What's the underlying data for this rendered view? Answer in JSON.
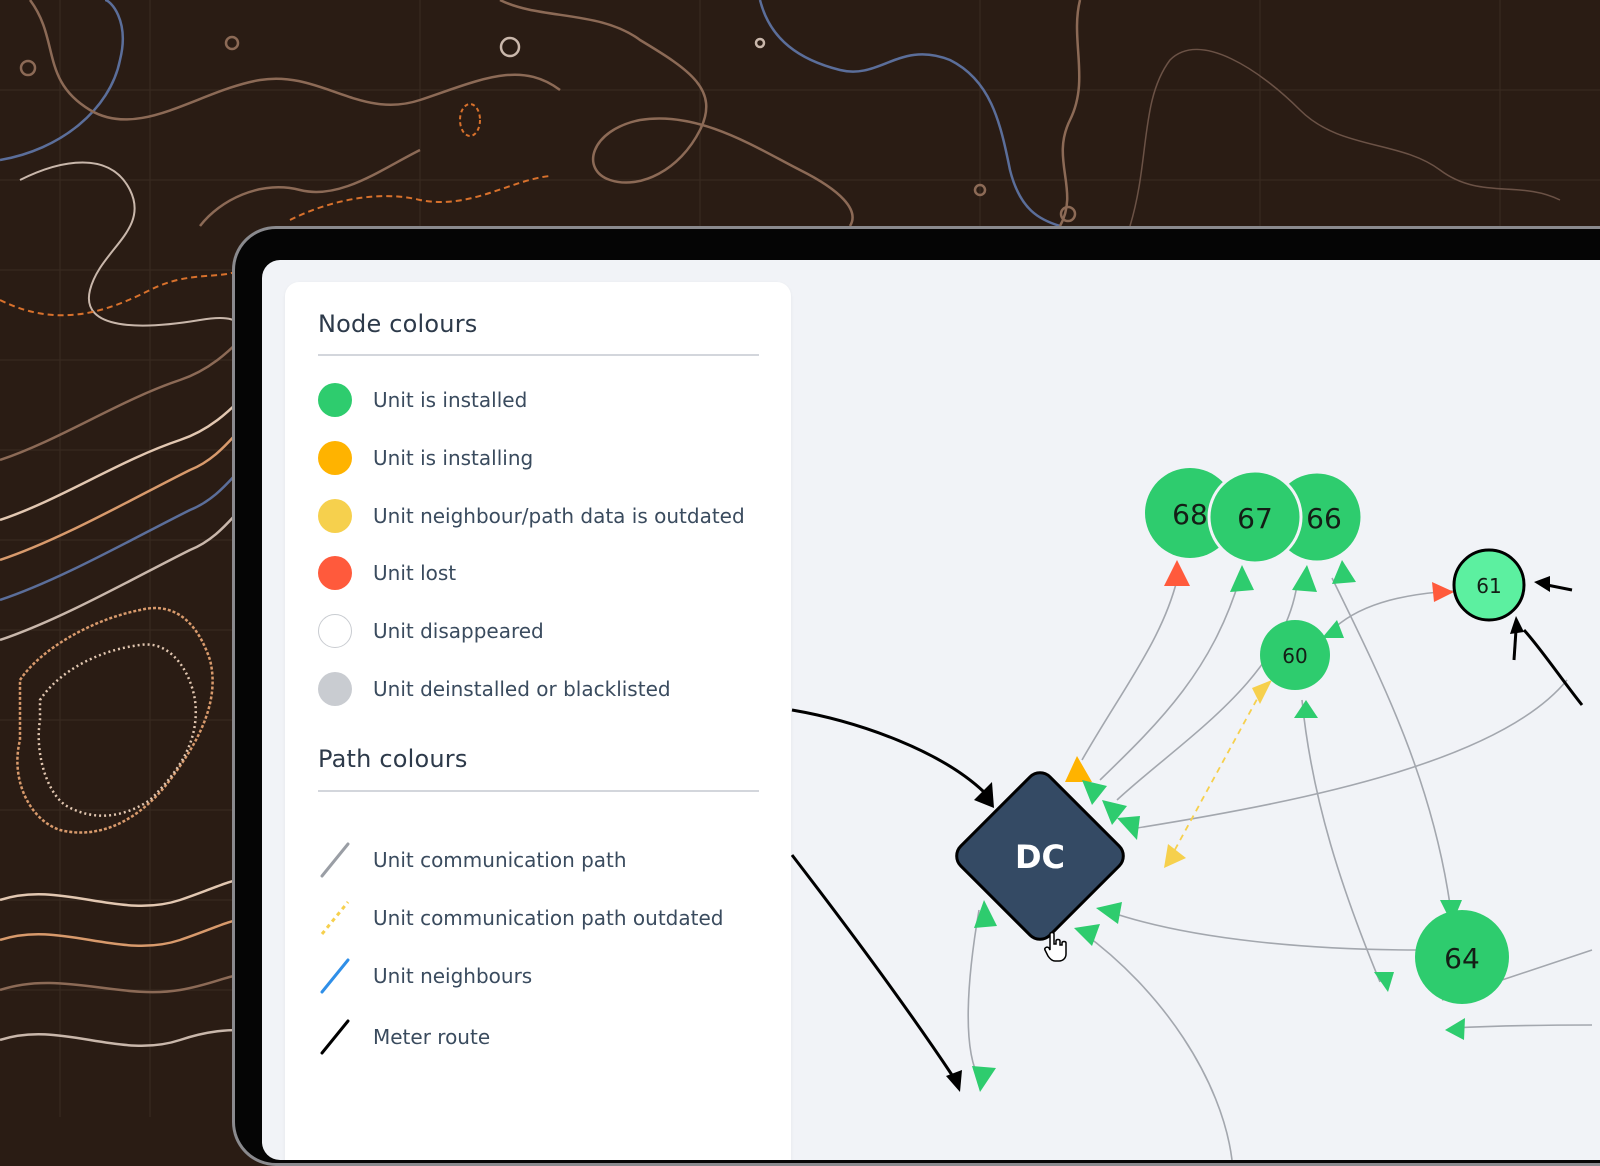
{
  "legend": {
    "node_title": "Node colours",
    "node_items": [
      {
        "label": "Unit is installed",
        "color": "#2ecc6e"
      },
      {
        "label": "Unit is installing",
        "color": "#ffb300"
      },
      {
        "label": "Unit neighbour/path data is outdated",
        "color": "#f6d04d"
      },
      {
        "label": "Unit lost",
        "color": "#ff5a3c"
      },
      {
        "label": "Unit disappeared",
        "color": "#ffffff"
      },
      {
        "label": "Unit deinstalled or blacklisted",
        "color": "#c9ccd1"
      }
    ],
    "path_title": "Path colours",
    "path_items": [
      {
        "label": "Unit communication path",
        "color": "#9a9ea5"
      },
      {
        "label": "Unit communication path outdated",
        "color": "#f6d04d"
      },
      {
        "label": "Unit neighbours",
        "color": "#2f8fe8"
      },
      {
        "label": "Meter route",
        "color": "#000000"
      }
    ]
  },
  "graph": {
    "hub_label": "DC",
    "nodes": [
      {
        "label": "68",
        "status": "installed"
      },
      {
        "label": "67",
        "status": "installed"
      },
      {
        "label": "66",
        "status": "installed"
      },
      {
        "label": "61",
        "status": "selected"
      },
      {
        "label": "60",
        "status": "installed"
      },
      {
        "label": "64",
        "status": "installed"
      }
    ]
  },
  "colors": {
    "background": "#2a1c14",
    "screen": "#f1f3f7",
    "hub": "#344a64",
    "installed": "#2ecc6e",
    "selected": "#5cf0a0"
  }
}
